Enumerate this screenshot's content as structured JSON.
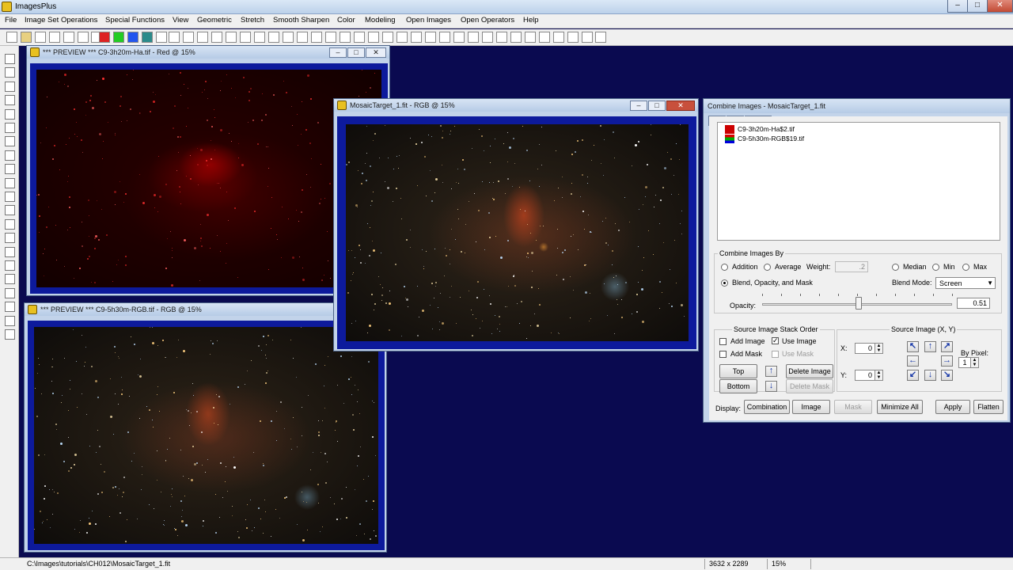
{
  "app": {
    "title": "ImagesPlus"
  },
  "menu": [
    "File",
    "Image Set Operations",
    "Special Functions",
    "View",
    "Geometric",
    "Stretch",
    "Smooth Sharpen",
    "Color",
    "Modeling",
    "Open Images",
    "Open Operators",
    "Help"
  ],
  "windows": {
    "ha_preview": {
      "title": "*** PREVIEW *** C9-3h20m-Ha.tif - Red @ 15%"
    },
    "rgb_preview": {
      "title": "*** PREVIEW *** C9-5h30m-RGB.tif - RGB @ 15%"
    },
    "mosaic": {
      "title": "MosaicTarget_1.fit - RGB @ 15%"
    }
  },
  "combine": {
    "title": "Combine Images - MosaicTarget_1.fit",
    "list": [
      {
        "label": "C9-3h20m-Ha$2.tif",
        "colors": [
          "#cc0000"
        ]
      },
      {
        "label": "C9-5h30m-RGB$19.tif",
        "colors": [
          "#dd0000",
          "#00aa00",
          "#0000dd"
        ]
      }
    ],
    "by_group": "Combine Images By",
    "addition": "Addition",
    "average": "Average",
    "weight_label": "Weight:",
    "weight_value": ".2",
    "median": "Median",
    "min": "Min",
    "max": "Max",
    "blend_radio": "Blend, Opacity, and Mask",
    "blend_mode_label": "Blend Mode:",
    "blend_mode_value": "Screen",
    "opacity_label": "Opacity:",
    "opacity_value": "0.51",
    "opacity_level": 0.51,
    "stack_group": "Source Image Stack Order",
    "add_image": "Add Image",
    "use_image": "Use Image",
    "add_mask": "Add Mask",
    "use_mask": "Use Mask",
    "top": "Top",
    "bottom": "Bottom",
    "delete_image": "Delete Image",
    "delete_mask": "Delete Mask",
    "source_group": "Source Image (X, Y)",
    "x_label": "X:",
    "x_value": "0",
    "y_label": "Y:",
    "y_value": "0",
    "by_pixel_label": "By Pixel:",
    "by_pixel_value": "1",
    "display_label": "Display:",
    "combination": "Combination",
    "image": "Image",
    "mask": "Mask",
    "minimize_all": "Minimize All",
    "apply": "Apply",
    "flatten": "Flatten"
  },
  "status": {
    "path": "C:\\Images\\tutorials\\CH012\\MosaicTarget_1.fit",
    "dims": "3632 x 2289",
    "zoom": "15%"
  }
}
